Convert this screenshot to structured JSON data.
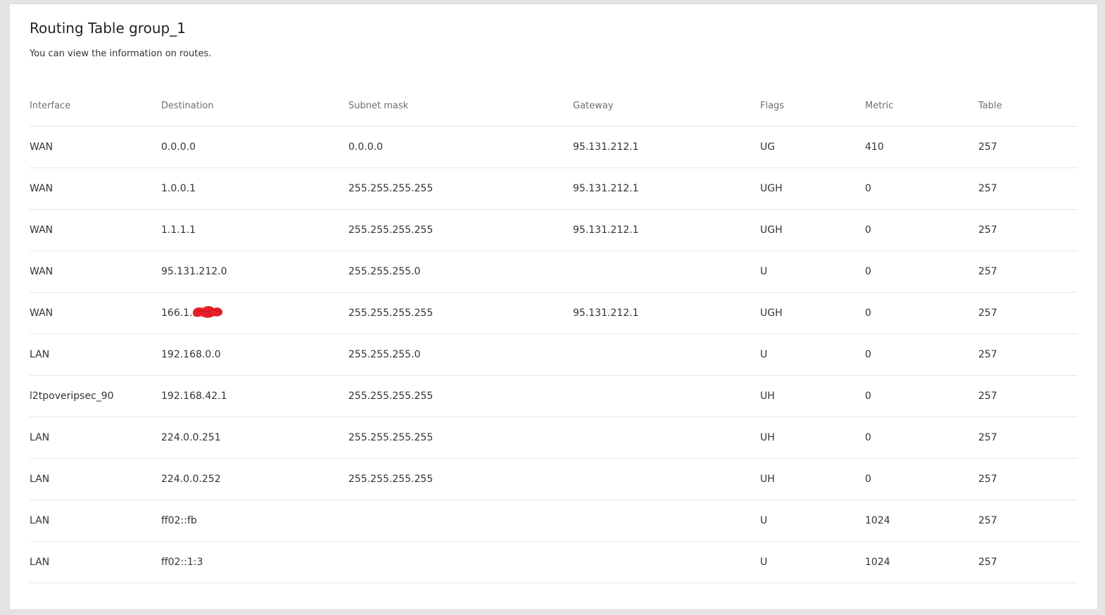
{
  "page": {
    "title": "Routing Table group_1",
    "subtitle": "You can view the information on routes."
  },
  "colors": {
    "background": "#e4e4e4",
    "card": "#ffffff",
    "text": "#333333",
    "header_text": "#6f6f6f",
    "divider": "#e6e6e6",
    "redaction": "#e8202a"
  },
  "table": {
    "headers": {
      "interface": "Interface",
      "destination": "Destination",
      "subnet_mask": "Subnet mask",
      "gateway": "Gateway",
      "flags": "Flags",
      "metric": "Metric",
      "table": "Table"
    },
    "rows": [
      {
        "interface": "WAN",
        "destination": "0.0.0.0",
        "subnet_mask": "0.0.0.0",
        "gateway": "95.131.212.1",
        "flags": "UG",
        "metric": "410",
        "table": "257"
      },
      {
        "interface": "WAN",
        "destination": "1.0.0.1",
        "subnet_mask": "255.255.255.255",
        "gateway": "95.131.212.1",
        "flags": "UGH",
        "metric": "0",
        "table": "257"
      },
      {
        "interface": "WAN",
        "destination": "1.1.1.1",
        "subnet_mask": "255.255.255.255",
        "gateway": "95.131.212.1",
        "flags": "UGH",
        "metric": "0",
        "table": "257"
      },
      {
        "interface": "WAN",
        "destination": "95.131.212.0",
        "subnet_mask": "255.255.255.0",
        "gateway": "",
        "flags": "U",
        "metric": "0",
        "table": "257"
      },
      {
        "interface": "WAN",
        "destination": "166.1.",
        "subnet_mask": "255.255.255.255",
        "gateway": "95.131.212.1",
        "flags": "UGH",
        "metric": "0",
        "table": "257"
      },
      {
        "interface": "LAN",
        "destination": "192.168.0.0",
        "subnet_mask": "255.255.255.0",
        "gateway": "",
        "flags": "U",
        "metric": "0",
        "table": "257"
      },
      {
        "interface": "l2tpoveripsec_90",
        "destination": "192.168.42.1",
        "subnet_mask": "255.255.255.255",
        "gateway": "",
        "flags": "UH",
        "metric": "0",
        "table": "257"
      },
      {
        "interface": "LAN",
        "destination": "224.0.0.251",
        "subnet_mask": "255.255.255.255",
        "gateway": "",
        "flags": "UH",
        "metric": "0",
        "table": "257"
      },
      {
        "interface": "LAN",
        "destination": "224.0.0.252",
        "subnet_mask": "255.255.255.255",
        "gateway": "",
        "flags": "UH",
        "metric": "0",
        "table": "257"
      },
      {
        "interface": "LAN",
        "destination": "ff02::fb",
        "subnet_mask": "",
        "gateway": "",
        "flags": "U",
        "metric": "1024",
        "table": "257"
      },
      {
        "interface": "LAN",
        "destination": "ff02::1:3",
        "subnet_mask": "",
        "gateway": "",
        "flags": "U",
        "metric": "1024",
        "table": "257"
      }
    ]
  }
}
